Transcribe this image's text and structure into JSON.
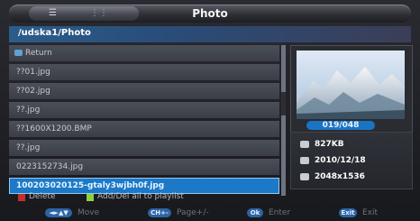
{
  "header": {
    "title": "Photo",
    "view_list_icon": "list-icon",
    "view_grid_icon": "grid-icon"
  },
  "path": {
    "current": "/udska1/Photo"
  },
  "files": {
    "items": [
      {
        "label": "Return",
        "type": "return"
      },
      {
        "label": "??01.jpg"
      },
      {
        "label": "??02.jpg"
      },
      {
        "label": "??.jpg"
      },
      {
        "label": "??1600X1200.BMP"
      },
      {
        "label": "??.jpg"
      },
      {
        "label": "0223152734.jpg"
      },
      {
        "label": "100203020125-gtaly3wjbh0f.jpg",
        "selected": true
      }
    ]
  },
  "preview": {
    "counter": "019/048"
  },
  "info": {
    "size": "827KB",
    "date": "2010/12/18",
    "resolution": "2048x1536"
  },
  "legend": {
    "delete": "Delete",
    "add_del": "Add/Del all to playlist"
  },
  "help": {
    "move_key": "◄►▲▼",
    "move": "Move",
    "page_key": "CH+-",
    "page": "Page+/-",
    "ok_key": "Ok",
    "enter": "Enter",
    "exit_key": "Exit",
    "exit": "Exit"
  },
  "colors": {
    "selected": "#1c79c8",
    "red": "#c2302e",
    "green": "#8bd23b",
    "accent": "#2c64a5"
  }
}
